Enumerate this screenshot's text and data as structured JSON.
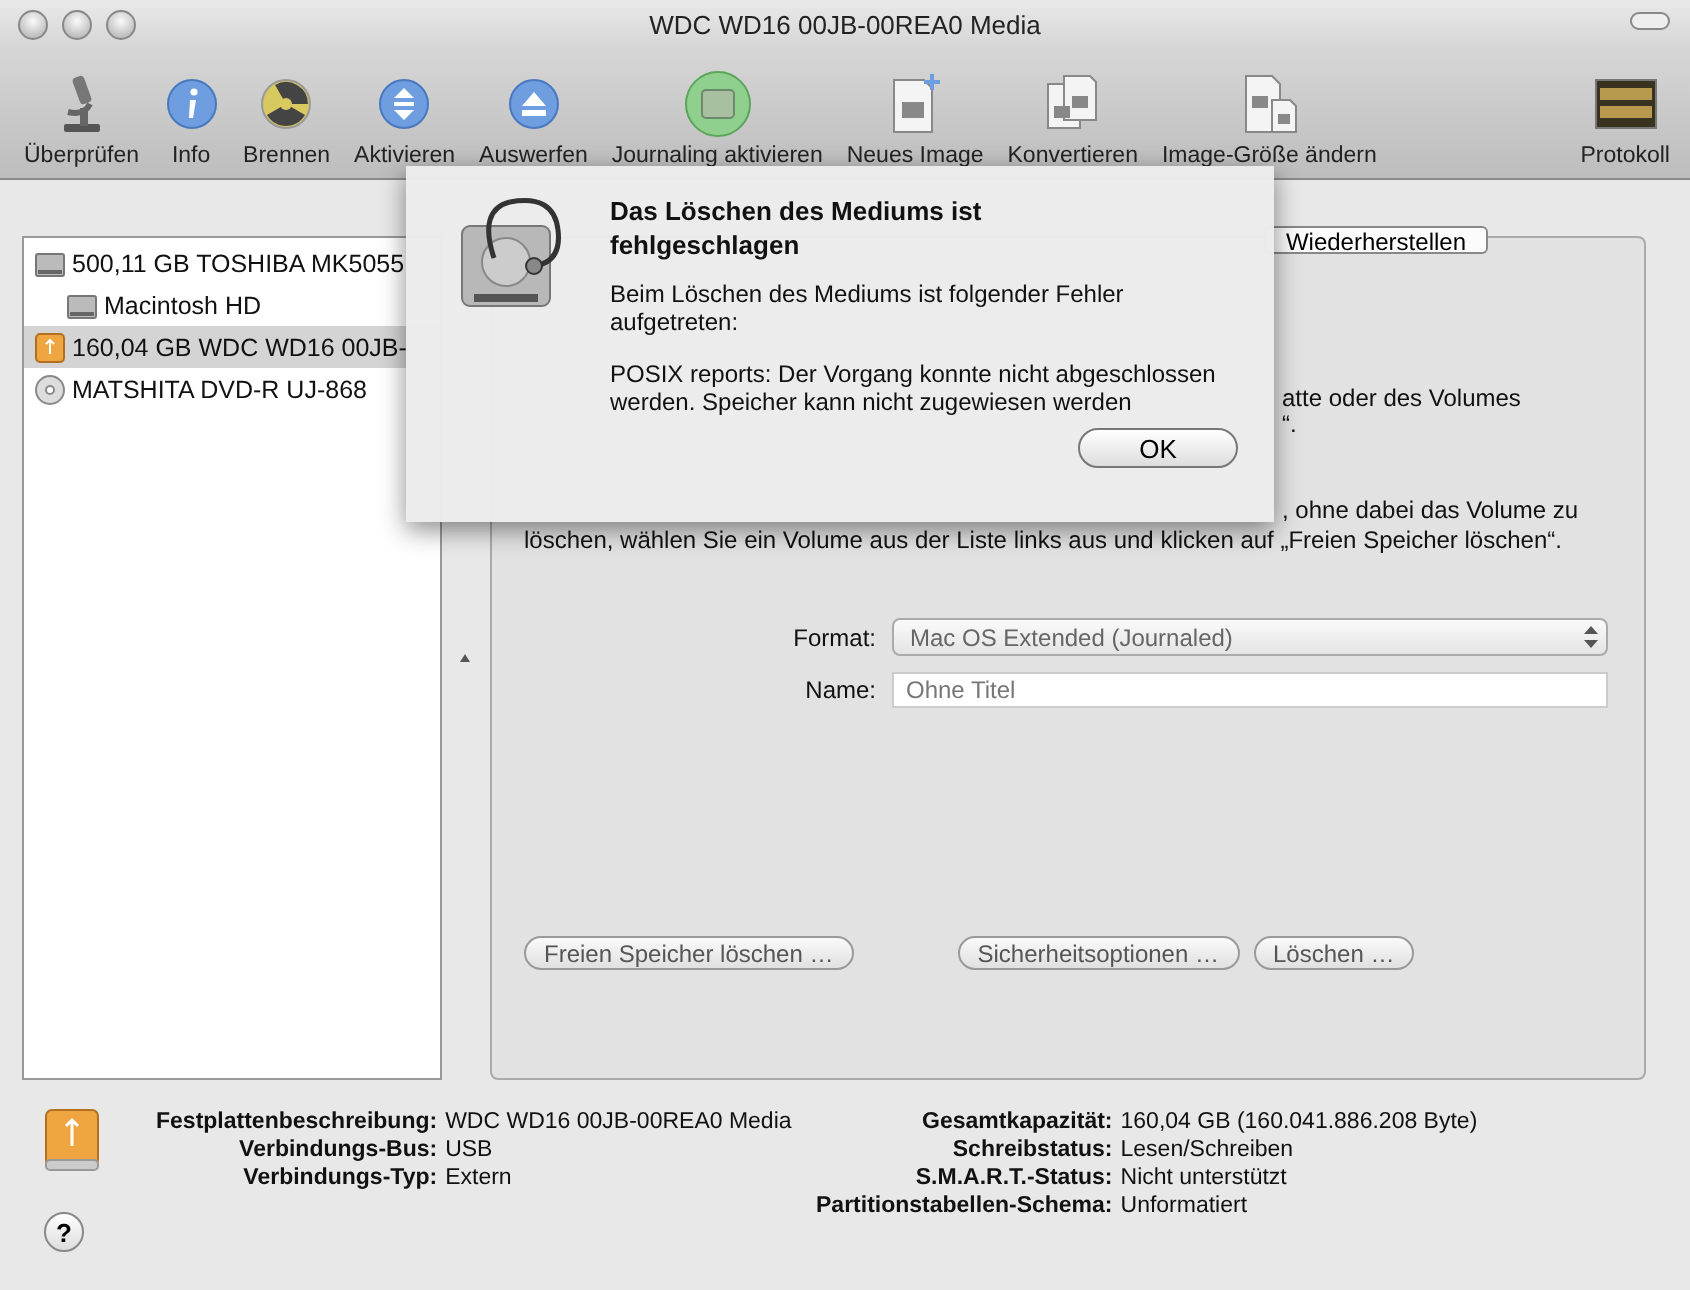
{
  "window": {
    "title": "WDC WD16 00JB-00REA0 Media"
  },
  "toolbar": [
    {
      "label": "Überprüfen",
      "kind": "microscope"
    },
    {
      "label": "Info",
      "kind": "info"
    },
    {
      "label": "Brennen",
      "kind": "burn"
    },
    {
      "label": "Aktivieren",
      "kind": "mount"
    },
    {
      "label": "Auswerfen",
      "kind": "eject"
    },
    {
      "label": "Journaling aktivieren",
      "kind": "journal"
    },
    {
      "label": "Neues Image",
      "kind": "new-image"
    },
    {
      "label": "Konvertieren",
      "kind": "convert"
    },
    {
      "label": "Image-Größe ändern",
      "kind": "resize"
    },
    {
      "label": "Protokoll",
      "kind": "log"
    }
  ],
  "sidebar": {
    "items": [
      {
        "label": "500,11 GB TOSHIBA MK5055",
        "kind": "hdd",
        "selected": false,
        "children": [
          {
            "label": "Macintosh HD",
            "kind": "volume",
            "selected": false
          }
        ]
      },
      {
        "label": "160,04 GB WDC WD16 00JB-",
        "kind": "external",
        "selected": true
      },
      {
        "label": "MATSHITA DVD-R UJ-868",
        "kind": "optical",
        "selected": false
      }
    ]
  },
  "tabs": [
    {
      "label": "Wiederherstellen",
      "selected": false
    }
  ],
  "panel": {
    "lines": [
      {
        "text": "atte oder des Volumes",
        "kind": "fragment"
      },
      {
        "text": "“.",
        "kind": "fragment"
      },
      {
        "text": ", ohne dabei das Volume zu",
        "kind": "fragment-gap"
      },
      {
        "text": "löschen, wählen Sie ein Volume aus der Liste links aus und klicken auf „Freien Speicher löschen“.",
        "kind": "full"
      }
    ],
    "format": {
      "label": "Format:",
      "value": "Mac OS Extended (Journaled)"
    },
    "name": {
      "label": "Name:",
      "value": "Ohne Titel"
    },
    "buttons": [
      "Freien Speicher löschen …",
      "Sicherheitsoptionen …",
      "Löschen …"
    ]
  },
  "info": {
    "left": [
      {
        "label": "Festplattenbeschreibung:",
        "value": "WDC WD16 00JB-00REA0 Media"
      },
      {
        "label": "Verbindungs-Bus:",
        "value": "USB"
      },
      {
        "label": "Verbindungs-Typ:",
        "value": "Extern"
      }
    ],
    "right": [
      {
        "label": "Gesamtkapazität:",
        "value": "160,04 GB (160.041.886.208 Byte)"
      },
      {
        "label": "Schreibstatus:",
        "value": "Lesen/Schreiben"
      },
      {
        "label": "S.M.A.R.T.-Status:",
        "value": "Nicht unterstützt"
      },
      {
        "label": "Partitionstabellen-Schema:",
        "value": "Unformatiert"
      }
    ],
    "help": "?"
  },
  "dialog": {
    "title": "Das Löschen des Mediums ist fehlgeschlagen",
    "message": "Beim Löschen des Mediums ist folgender Fehler aufgetreten:",
    "detail": "POSIX reports: Der Vorgang konnte nicht abgeschlossen werden. Speicher kann nicht zugewiesen werden",
    "button": "OK"
  }
}
